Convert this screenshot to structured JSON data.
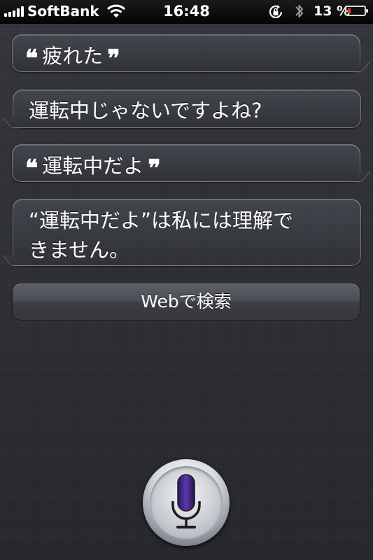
{
  "status_bar": {
    "carrier": "SoftBank",
    "time": "16:48",
    "battery_percent": "13 %",
    "battery_level": 0.13,
    "icons": [
      "signal-icon",
      "wifi-icon",
      "orientation-lock-icon",
      "bluetooth-icon",
      "battery-icon"
    ]
  },
  "conversation": {
    "user_1": {
      "open_quote": "❝",
      "text": "疲れた",
      "close_quote": "❞"
    },
    "siri_1": {
      "text": "運転中じゃないですよね?"
    },
    "user_2": {
      "open_quote": "❝",
      "text": "運転中だよ",
      "close_quote": "❞"
    },
    "siri_2": {
      "line1": "“運転中だよ”は私には理解で",
      "line2": "きません。"
    }
  },
  "actions": {
    "web_search": "Webで検索"
  },
  "mic": {
    "icon": "microphone-icon",
    "accent": "#4b2a8c"
  }
}
